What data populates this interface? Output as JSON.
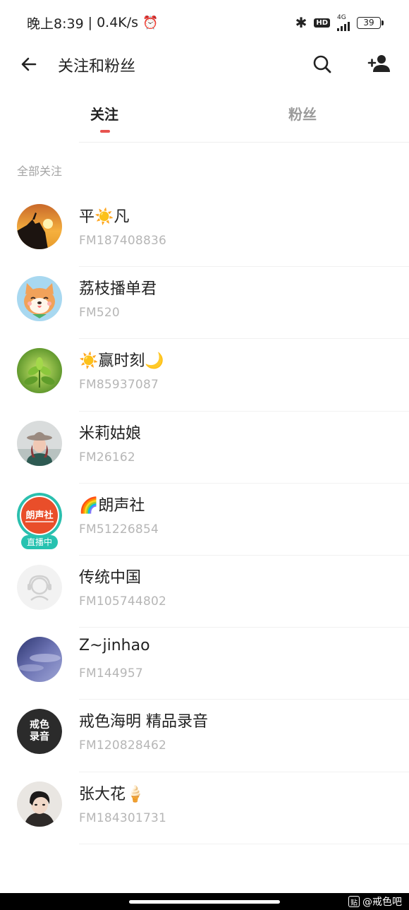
{
  "status_bar": {
    "time": "晚上8:39",
    "separator": "|",
    "speed": "0.4K/s",
    "network": "4G",
    "battery": "39",
    "icons": [
      "alarm-icon",
      "bluetooth-icon",
      "hd-icon",
      "signal-icon",
      "battery-icon"
    ]
  },
  "header": {
    "title": "关注和粉丝",
    "icons": [
      "back-icon",
      "search-icon",
      "add-user-icon"
    ]
  },
  "tabs": [
    {
      "label": "关注",
      "active": true
    },
    {
      "label": "粉丝",
      "active": false
    }
  ],
  "section_label": "全部关注",
  "follows": [
    {
      "name": "平☀️凡",
      "fm": "FM187408836",
      "live": false
    },
    {
      "name": "荔枝播单君",
      "fm": "FM520",
      "live": false
    },
    {
      "name": "☀️赢时刻🌙",
      "fm": "FM85937087",
      "live": false
    },
    {
      "name": "米莉姑娘",
      "fm": "FM26162",
      "live": false
    },
    {
      "name": "🌈朗声社",
      "fm": "FM51226854",
      "live": true,
      "live_label": "直播中",
      "avatar_text": "朗声社"
    },
    {
      "name": "传统中国",
      "fm": "FM105744802",
      "live": false
    },
    {
      "name": "Z~jinhao",
      "fm": "FM144957",
      "live": false
    },
    {
      "name": "戒色海明 精品录音",
      "fm": "FM120828462",
      "live": false,
      "avatar_text": "戒色录音"
    },
    {
      "name": "张大花🍦",
      "fm": "FM184301731",
      "live": false
    }
  ],
  "watermark": "@戒色吧",
  "colors": {
    "accent": "#e8534f",
    "live_badge": "#27c2b0",
    "muted_text": "#b6b6b6"
  }
}
